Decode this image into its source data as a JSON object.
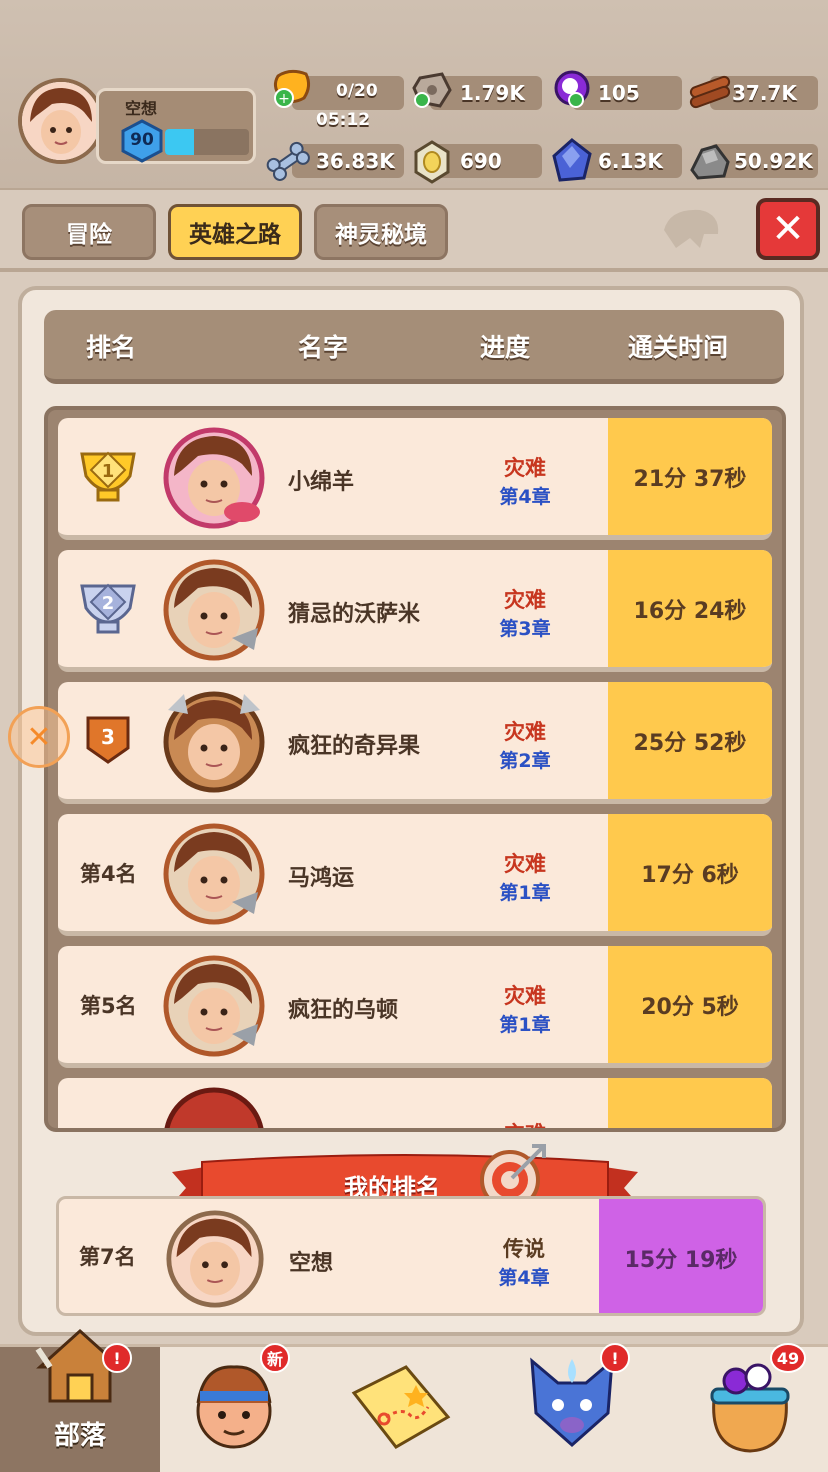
{
  "player": {
    "name": "空想",
    "level": "90",
    "xp_fraction": 0.35
  },
  "resources": {
    "stamina": "0/20",
    "stamina_timer": "05:12",
    "stone": "1.79K",
    "orb": "105",
    "wood": "37.7K",
    "bone": "36.83K",
    "egg": "690",
    "gem": "6.13K",
    "ore": "50.92K"
  },
  "tabs": [
    {
      "label": "冒险",
      "active": false
    },
    {
      "label": "英雄之路",
      "active": true
    },
    {
      "label": "神灵秘境",
      "active": false
    }
  ],
  "close_label": "✕",
  "table": {
    "headers": [
      "排名",
      "名字",
      "进度",
      "通关时间"
    ],
    "rows": [
      {
        "rank": "1",
        "name": "小绵羊",
        "difficulty": "灾难",
        "chapter": "第4章",
        "time": "21分 37秒"
      },
      {
        "rank": "2",
        "name": "猜忌的沃萨米",
        "difficulty": "灾难",
        "chapter": "第3章",
        "time": "16分 24秒"
      },
      {
        "rank": "3",
        "name": "疯狂的奇异果",
        "difficulty": "灾难",
        "chapter": "第2章",
        "time": "25分 52秒"
      },
      {
        "rank": "第4名",
        "name": "马鸿运",
        "difficulty": "灾难",
        "chapter": "第1章",
        "time": "17分 6秒"
      },
      {
        "rank": "第5名",
        "name": "疯狂的乌顿",
        "difficulty": "灾难",
        "chapter": "第1章",
        "time": "20分 5秒"
      },
      {
        "rank": "",
        "name": "",
        "difficulty": "灾难",
        "chapter": "",
        "time": ""
      }
    ]
  },
  "my_rank": {
    "banner": "我的排名",
    "rank": "第7名",
    "name": "空想",
    "difficulty": "传说",
    "chapter": "第4章",
    "time": "15分 19秒"
  },
  "bottom_nav": [
    {
      "label": "部落",
      "badge": "!"
    },
    {
      "label": "",
      "badge": "新"
    },
    {
      "label": "",
      "badge": ""
    },
    {
      "label": "",
      "badge": "!"
    },
    {
      "label": "",
      "badge": "49"
    }
  ],
  "colors": {
    "accent": "#ffd154",
    "time_bg": "#ffc94d",
    "my_time_bg": "#cf62e6",
    "difficulty": "#c7361f",
    "chapter": "#2b51c4"
  }
}
